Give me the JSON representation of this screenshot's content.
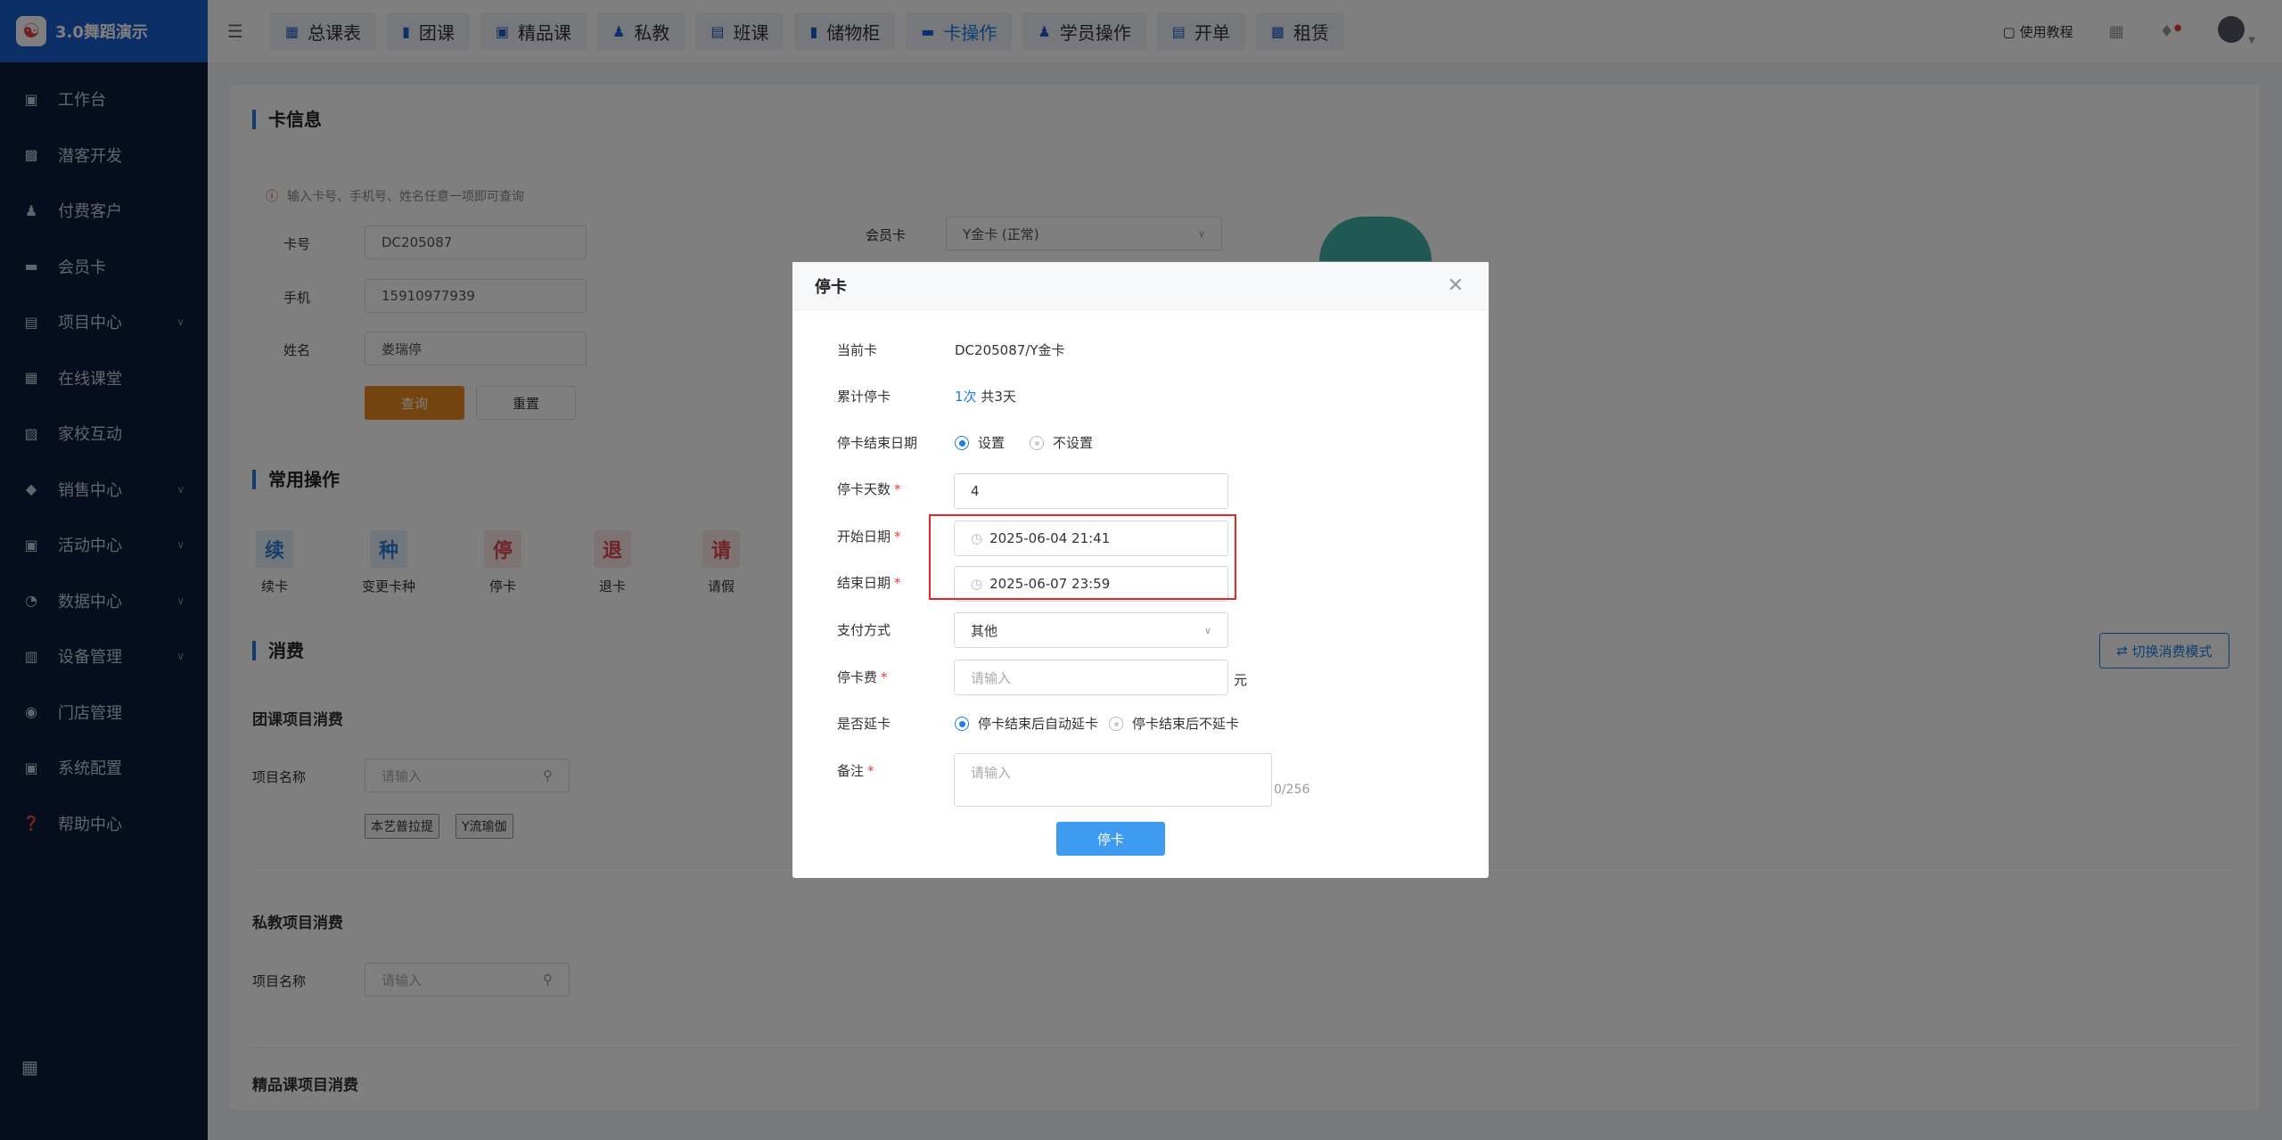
{
  "app": {
    "name": "3.0舞蹈演示"
  },
  "sidebar": {
    "items": [
      {
        "label": "工作台",
        "icon": "image-icon"
      },
      {
        "label": "潜客开发",
        "icon": "id-card-icon"
      },
      {
        "label": "付费客户",
        "icon": "users-icon"
      },
      {
        "label": "会员卡",
        "icon": "card-icon"
      },
      {
        "label": "项目中心",
        "icon": "list-icon",
        "expandable": true
      },
      {
        "label": "在线课堂",
        "icon": "calendar-icon"
      },
      {
        "label": "家校互动",
        "icon": "contact-icon"
      },
      {
        "label": "销售中心",
        "icon": "tag-icon",
        "expandable": true
      },
      {
        "label": "活动中心",
        "icon": "gift-icon",
        "expandable": true
      },
      {
        "label": "数据中心",
        "icon": "pie-chart-icon",
        "expandable": true
      },
      {
        "label": "设备管理",
        "icon": "device-icon",
        "expandable": true
      },
      {
        "label": "门店管理",
        "icon": "location-icon"
      },
      {
        "label": "系统配置",
        "icon": "monitor-icon"
      },
      {
        "label": "帮助中心",
        "icon": "help-icon"
      }
    ]
  },
  "topnav": {
    "tabs": [
      {
        "label": "总课表",
        "icon": "grid-icon"
      },
      {
        "label": "团课",
        "icon": "book-icon"
      },
      {
        "label": "精品课",
        "icon": "star-book-icon"
      },
      {
        "label": "私教",
        "icon": "users-icon"
      },
      {
        "label": "班课",
        "icon": "screen-icon"
      },
      {
        "label": "储物柜",
        "icon": "locker-icon"
      },
      {
        "label": "卡操作",
        "icon": "card-icon",
        "active": true
      },
      {
        "label": "学员操作",
        "icon": "user-icon"
      },
      {
        "label": "开单",
        "icon": "order-icon"
      },
      {
        "label": "租赁",
        "icon": "building-icon"
      }
    ],
    "tutorial": "使用教程"
  },
  "card_info": {
    "title": "卡信息",
    "hint": "输入卡号、手机号、姓名任意一项即可查询",
    "card_no_label": "卡号",
    "card_no": "DC205087",
    "phone_label": "手机",
    "phone": "15910977939",
    "name_label": "姓名",
    "name": "娄瑞停",
    "query_btn": "查询",
    "reset_btn": "重置",
    "member_card_label": "会员卡",
    "member_card": "Y金卡 (正常)"
  },
  "common_ops": {
    "title": "常用操作",
    "items": [
      {
        "glyph": "续",
        "label": "续卡",
        "color": "#2f7fd6",
        "bg": "#e3effb"
      },
      {
        "glyph": "种",
        "label": "变更卡种",
        "color": "#2f7fd6",
        "bg": "#e3effb"
      },
      {
        "glyph": "停",
        "label": "停卡",
        "color": "#e0474c",
        "bg": "#fbe6e7"
      },
      {
        "glyph": "退",
        "label": "退卡",
        "color": "#e0474c",
        "bg": "#fbe6e7"
      },
      {
        "glyph": "请",
        "label": "请假",
        "color": "#e0474c",
        "bg": "#fbe6e7"
      }
    ]
  },
  "consume": {
    "title": "消费",
    "switch_mode": "切换消费模式",
    "group": {
      "title": "团课项目消费",
      "field_label": "项目名称",
      "placeholder": "请输入",
      "tags": [
        "本艺普拉提",
        "Y流瑜伽"
      ]
    },
    "private": {
      "title": "私教项目消费",
      "field_label": "项目名称",
      "placeholder": "请输入"
    },
    "boutique_title": "精品课项目消费"
  },
  "modal": {
    "title": "停卡",
    "current_card_label": "当前卡",
    "current_card": "DC205087/Y金卡",
    "total_stop_label": "累计停卡",
    "total_stop_count": "1次",
    "total_stop_days": "共3天",
    "end_date_mode_label": "停卡结束日期",
    "end_date_mode_options": [
      "设置",
      "不设置"
    ],
    "end_date_mode_selected": 0,
    "days_label": "停卡天数",
    "days_value": "4",
    "start_label": "开始日期",
    "start_value": "2025-06-04 21:41",
    "end_label": "结束日期",
    "end_value": "2025-06-07 23:59",
    "pay_label": "支付方式",
    "pay_value": "其他",
    "fee_label": "停卡费",
    "fee_placeholder": "请输入",
    "fee_unit": "元",
    "extend_label": "是否延卡",
    "extend_options": [
      "停卡结束后自动延卡",
      "停卡结束后不延卡"
    ],
    "extend_selected": 0,
    "note_label": "备注",
    "note_placeholder": "请输入",
    "note_counter": "0/256",
    "submit": "停卡",
    "highlight_color": "#e52525"
  }
}
